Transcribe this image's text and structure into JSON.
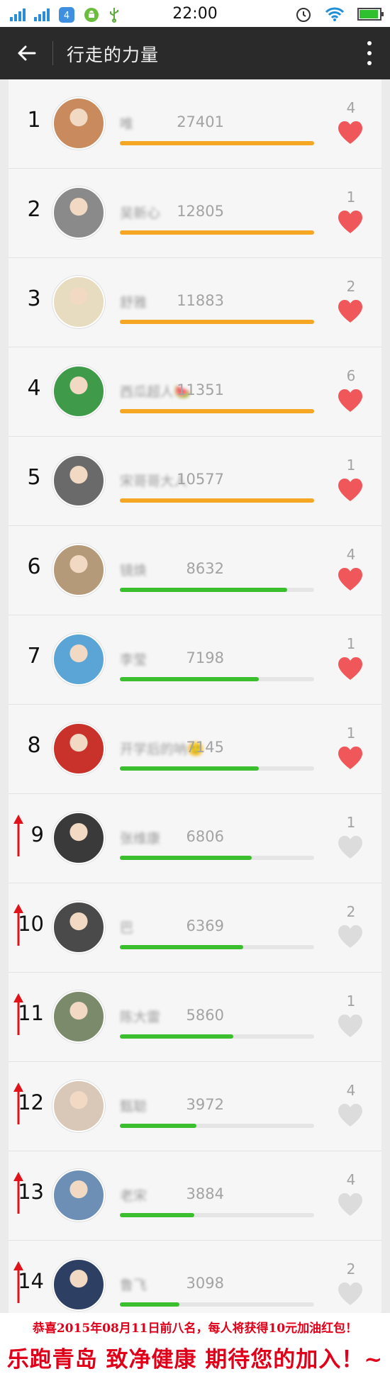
{
  "status_bar": {
    "time": "22:00",
    "notification_badge": "4",
    "icons": [
      "signal-icon",
      "signal-icon",
      "notification-badge-icon",
      "android-icon",
      "usb-icon",
      "alarm-icon",
      "wifi-icon",
      "battery-icon"
    ]
  },
  "app_bar": {
    "title": "行走的力量",
    "back_icon": "back-arrow-icon",
    "menu_icon": "overflow-menu-icon"
  },
  "colors": {
    "orange": "#f5a623",
    "green": "#3cbf2e",
    "heart_active": "#f0575a",
    "heart_inactive": "#dcdcdc",
    "arrow_up": "#e2121b"
  },
  "ranking": [
    {
      "rank": "1",
      "name": "唯",
      "steps": "27401",
      "likes": "4",
      "progress": 1.0,
      "bar_color": "orange",
      "liked": true,
      "rising": false,
      "avatar": "#c98b5e"
    },
    {
      "rank": "2",
      "name": "吴新心",
      "steps": "12805",
      "likes": "1",
      "progress": 1.0,
      "bar_color": "orange",
      "liked": true,
      "rising": false,
      "avatar": "#8a8a8a"
    },
    {
      "rank": "3",
      "name": "舒雅",
      "steps": "11883",
      "likes": "2",
      "progress": 1.0,
      "bar_color": "orange",
      "liked": true,
      "rising": false,
      "avatar": "#e8dcc0"
    },
    {
      "rank": "4",
      "name": "西瓜超人🍉",
      "steps": "11351",
      "likes": "6",
      "progress": 1.0,
      "bar_color": "orange",
      "liked": true,
      "rising": false,
      "avatar": "#3f9a4a"
    },
    {
      "rank": "5",
      "name": "宋哥哥大人",
      "steps": "10577",
      "likes": "1",
      "progress": 1.0,
      "bar_color": "orange",
      "liked": true,
      "rising": false,
      "avatar": "#6a6a6a"
    },
    {
      "rank": "6",
      "name": "镜焕",
      "steps": "8632",
      "likes": "4",
      "progress": 0.86,
      "bar_color": "green",
      "liked": true,
      "rising": false,
      "avatar": "#b59a7a"
    },
    {
      "rank": "7",
      "name": "李莹",
      "steps": "7198",
      "likes": "1",
      "progress": 0.715,
      "bar_color": "green",
      "liked": true,
      "rising": false,
      "avatar": "#5aa5d6"
    },
    {
      "rank": "8",
      "name": "开学后的呐🙂",
      "steps": "7145",
      "likes": "1",
      "progress": 0.715,
      "bar_color": "green",
      "liked": true,
      "rising": false,
      "avatar": "#c8322a"
    },
    {
      "rank": "9",
      "name": "张维康",
      "steps": "6806",
      "likes": "1",
      "progress": 0.68,
      "bar_color": "green",
      "liked": false,
      "rising": true,
      "avatar": "#3a3a3a"
    },
    {
      "rank": "10",
      "name": "巴",
      "steps": "6369",
      "likes": "2",
      "progress": 0.635,
      "bar_color": "green",
      "liked": false,
      "rising": true,
      "avatar": "#4a4a4a"
    },
    {
      "rank": "11",
      "name": "陈大雷",
      "steps": "5860",
      "likes": "1",
      "progress": 0.585,
      "bar_color": "green",
      "liked": false,
      "rising": true,
      "avatar": "#7a8a6a"
    },
    {
      "rank": "12",
      "name": "甄聪",
      "steps": "3972",
      "likes": "4",
      "progress": 0.395,
      "bar_color": "green",
      "liked": false,
      "rising": true,
      "avatar": "#d9c8b8"
    },
    {
      "rank": "13",
      "name": "老宋",
      "steps": "3884",
      "likes": "4",
      "progress": 0.385,
      "bar_color": "green",
      "liked": false,
      "rising": true,
      "avatar": "#6d8fb5"
    },
    {
      "rank": "14",
      "name": "鲁飞",
      "steps": "3098",
      "likes": "2",
      "progress": 0.305,
      "bar_color": "green",
      "liked": false,
      "rising": true,
      "avatar": "#2d3f63"
    }
  ],
  "banner": {
    "line1": "恭喜2015年08月11日前八名，每人将获得10元加油红包！",
    "line2": "乐跑青岛 致净健康 期待您的加入！~"
  }
}
